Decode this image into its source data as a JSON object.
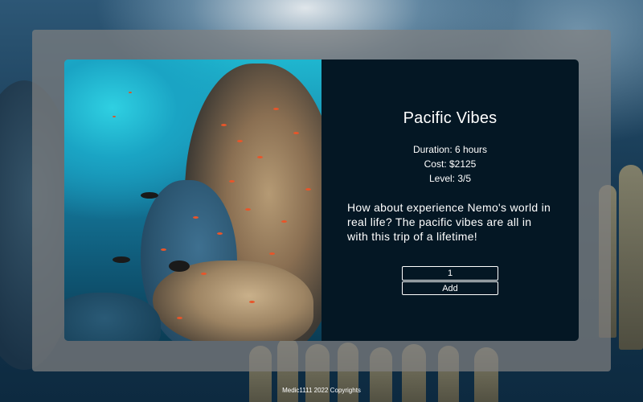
{
  "trip": {
    "title": "Pacific Vibes",
    "duration": "Duration: 6 hours",
    "cost": "Cost: $2125",
    "level": "Level: 3/5",
    "description": "How about experience Nemo's world in real life? The pacific vibes are all in with this trip of a lifetime!",
    "image": "coral-reef-with-orange-fish-photo"
  },
  "cart": {
    "quantity": "1",
    "add_label": "Add"
  },
  "footer": {
    "copyright": "Medic1111 2022 Copyrights"
  },
  "colors": {
    "info_panel": "#041724",
    "overlay": "#808080",
    "text": "#ffffff"
  }
}
